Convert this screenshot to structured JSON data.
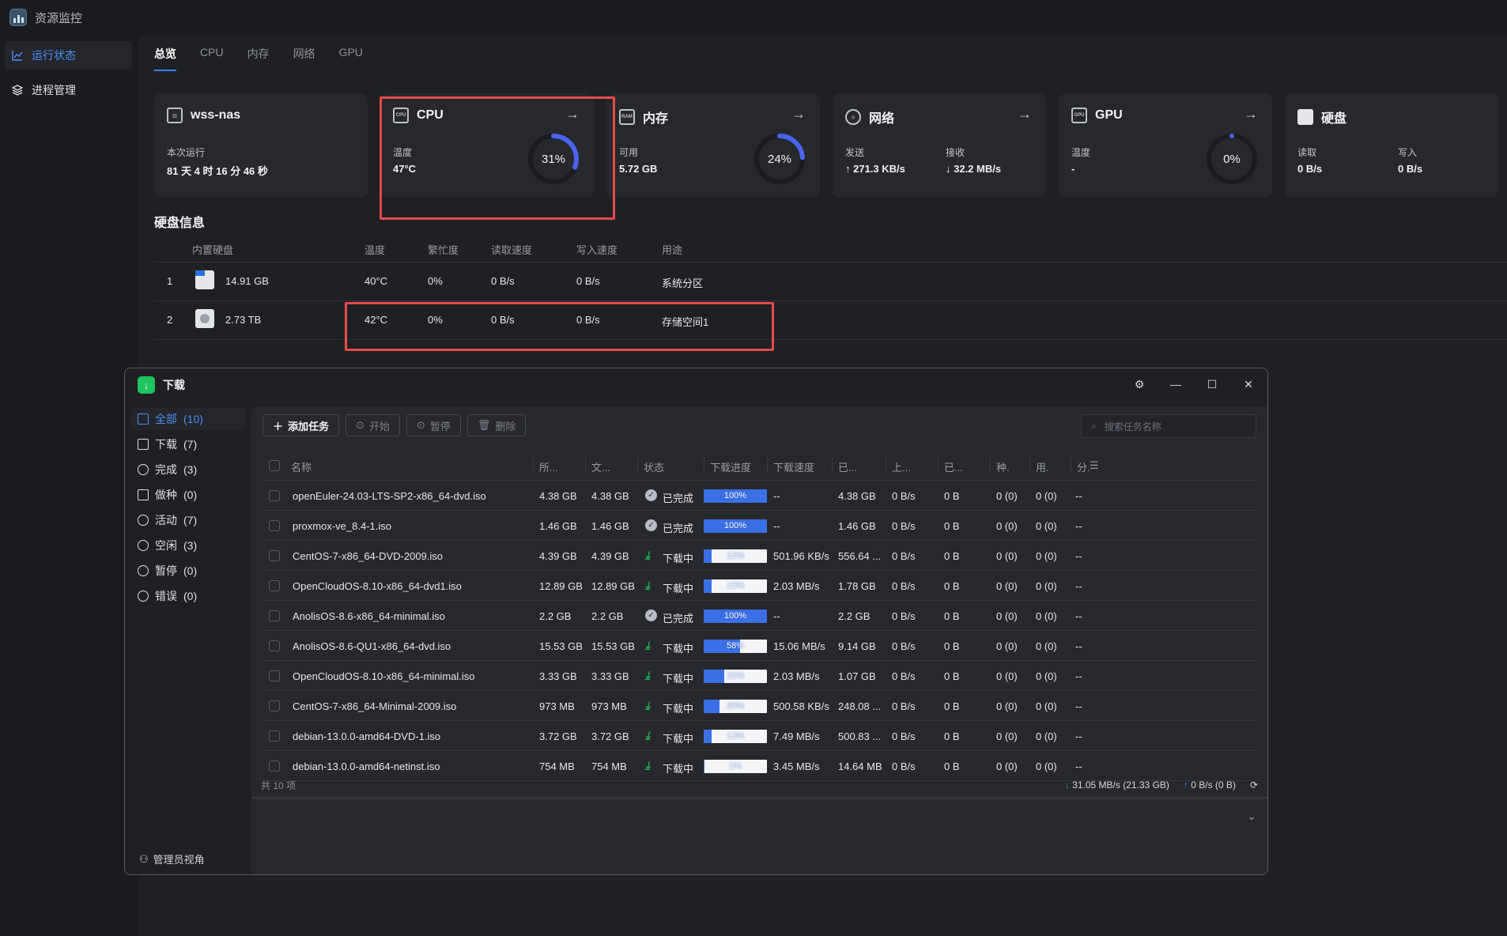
{
  "app": {
    "title": "资源监控"
  },
  "sidebar": {
    "items": [
      {
        "label": "运行状态"
      },
      {
        "label": "进程管理"
      }
    ]
  },
  "tabs": [
    "总览",
    "CPU",
    "内存",
    "网络",
    "GPU"
  ],
  "cards": {
    "host": {
      "title": "wss-nas",
      "label": "本次运行",
      "value": "81 天 4 时 16 分 46 秒"
    },
    "cpu": {
      "title": "CPU",
      "label": "温度",
      "value": "47°C",
      "gauge": "31%",
      "percent": 31,
      "chip": "CPU"
    },
    "mem": {
      "title": "内存",
      "label": "可用",
      "value": "5.72 GB",
      "gauge": "24%",
      "percent": 24,
      "chip": "RAM"
    },
    "net": {
      "title": "网络",
      "send_label": "发送",
      "send_value": "↑ 271.3 KB/s",
      "recv_label": "接收",
      "recv_value": "↓ 32.2 MB/s"
    },
    "gpu": {
      "title": "GPU",
      "label": "温度",
      "value": "-",
      "gauge": "0%",
      "percent": 0,
      "chip": "GPU"
    },
    "disk": {
      "title": "硬盘",
      "read_label": "读取",
      "read_value": "0 B/s",
      "write_label": "写入",
      "write_value": "0 B/s"
    }
  },
  "disk_section": {
    "title": "硬盘信息",
    "headers": [
      "内置硬盘",
      "温度",
      "繁忙度",
      "读取速度",
      "写入速度",
      "用途"
    ],
    "rows": [
      {
        "idx": "1",
        "icon": "ssd-icon",
        "size": "14.91 GB",
        "temp": "40°C",
        "busy": "0%",
        "read": "0 B/s",
        "write": "0 B/s",
        "use": "系统分区"
      },
      {
        "idx": "2",
        "icon": "hdd-icon",
        "size": "2.73 TB",
        "temp": "42°C",
        "busy": "0%",
        "read": "0 B/s",
        "write": "0 B/s",
        "use": "存储空间1"
      }
    ]
  },
  "download": {
    "title": "下载",
    "nav": [
      {
        "label": "全部",
        "count": "(10)"
      },
      {
        "label": "下载",
        "count": "(7)"
      },
      {
        "label": "完成",
        "count": "(3)"
      },
      {
        "label": "做种",
        "count": "(0)"
      },
      {
        "label": "活动",
        "count": "(7)"
      },
      {
        "label": "空闲",
        "count": "(3)"
      },
      {
        "label": "暂停",
        "count": "(0)"
      },
      {
        "label": "错误",
        "count": "(0)"
      }
    ],
    "admin_label": "管理员视角",
    "toolbar": {
      "add": "添加任务",
      "start": "开始",
      "pause": "暂停",
      "delete": "删除"
    },
    "search_placeholder": "搜索任务名称",
    "headers": [
      "名称",
      "所...",
      "文...",
      "状态",
      "下载进度",
      "下载速度",
      "已...",
      "上...",
      "已...",
      "种.",
      "用.",
      "分."
    ],
    "rows": [
      {
        "name": "openEuler-24.03-LTS-SP2-x86_64-dvd.iso",
        "size": "4.38 GB",
        "file": "4.38 GB",
        "status": "已完成",
        "done": true,
        "progress": 100,
        "progress_text": "100%",
        "speed": "--",
        "downloaded": "4.38 GB",
        "up_speed": "0 B/s",
        "uploaded": "0 B",
        "seeds": "0 (0)",
        "peers": "0 (0)",
        "ratio": "--"
      },
      {
        "name": "proxmox-ve_8.4-1.iso",
        "size": "1.46 GB",
        "file": "1.46 GB",
        "status": "已完成",
        "done": true,
        "progress": 100,
        "progress_text": "100%",
        "speed": "--",
        "downloaded": "1.46 GB",
        "up_speed": "0 B/s",
        "uploaded": "0 B",
        "seeds": "0 (0)",
        "peers": "0 (0)",
        "ratio": "--"
      },
      {
        "name": "CentOS-7-x86_64-DVD-2009.iso",
        "size": "4.39 GB",
        "file": "4.39 GB",
        "status": "下载中",
        "done": false,
        "progress": 12,
        "progress_text": "12%",
        "speed": "501.96 KB/s",
        "downloaded": "556.64 ...",
        "up_speed": "0 B/s",
        "uploaded": "0 B",
        "seeds": "0 (0)",
        "peers": "0 (0)",
        "ratio": "--"
      },
      {
        "name": "OpenCloudOS-8.10-x86_64-dvd1.iso",
        "size": "12.89 GB",
        "file": "12.89 GB",
        "status": "下载中",
        "done": false,
        "progress": 13,
        "progress_text": "13%",
        "speed": "2.03 MB/s",
        "downloaded": "1.78 GB",
        "up_speed": "0 B/s",
        "uploaded": "0 B",
        "seeds": "0 (0)",
        "peers": "0 (0)",
        "ratio": "--"
      },
      {
        "name": "AnolisOS-8.6-x86_64-minimal.iso",
        "size": "2.2 GB",
        "file": "2.2 GB",
        "status": "已完成",
        "done": true,
        "progress": 100,
        "progress_text": "100%",
        "speed": "--",
        "downloaded": "2.2 GB",
        "up_speed": "0 B/s",
        "uploaded": "0 B",
        "seeds": "0 (0)",
        "peers": "0 (0)",
        "ratio": "--"
      },
      {
        "name": "AnolisOS-8.6-QU1-x86_64-dvd.iso",
        "size": "15.53 GB",
        "file": "15.53 GB",
        "status": "下载中",
        "done": false,
        "progress": 58,
        "progress_text": "58%",
        "speed": "15.06 MB/s",
        "downloaded": "9.14 GB",
        "up_speed": "0 B/s",
        "uploaded": "0 B",
        "seeds": "0 (0)",
        "peers": "0 (0)",
        "ratio": "--"
      },
      {
        "name": "OpenCloudOS-8.10-x86_64-minimal.iso",
        "size": "3.33 GB",
        "file": "3.33 GB",
        "status": "下载中",
        "done": false,
        "progress": 32,
        "progress_text": "32%",
        "speed": "2.03 MB/s",
        "downloaded": "1.07 GB",
        "up_speed": "0 B/s",
        "uploaded": "0 B",
        "seeds": "0 (0)",
        "peers": "0 (0)",
        "ratio": "--"
      },
      {
        "name": "CentOS-7-x86_64-Minimal-2009.iso",
        "size": "973 MB",
        "file": "973 MB",
        "status": "下载中",
        "done": false,
        "progress": 25,
        "progress_text": "25%",
        "speed": "500.58 KB/s",
        "downloaded": "248.08 ...",
        "up_speed": "0 B/s",
        "uploaded": "0 B",
        "seeds": "0 (0)",
        "peers": "0 (0)",
        "ratio": "--"
      },
      {
        "name": "debian-13.0.0-amd64-DVD-1.iso",
        "size": "3.72 GB",
        "file": "3.72 GB",
        "status": "下载中",
        "done": false,
        "progress": 13,
        "progress_text": "13%",
        "speed": "7.49 MB/s",
        "downloaded": "500.83 ...",
        "up_speed": "0 B/s",
        "uploaded": "0 B",
        "seeds": "0 (0)",
        "peers": "0 (0)",
        "ratio": "--"
      },
      {
        "name": "debian-13.0.0-amd64-netinst.iso",
        "size": "754 MB",
        "file": "754 MB",
        "status": "下载中",
        "done": false,
        "progress": 1,
        "progress_text": "1%",
        "speed": "3.45 MB/s",
        "downloaded": "14.64 MB",
        "up_speed": "0 B/s",
        "uploaded": "0 B",
        "seeds": "0 (0)",
        "peers": "0 (0)",
        "ratio": "--"
      }
    ],
    "footer": {
      "total": "共 10 项",
      "down": "31.05 MB/s (21.33 GB)",
      "up": "0 B/s (0 B)"
    }
  },
  "colors": {
    "accent": "#3e7bef",
    "highlight": "#e84a4a",
    "download_green": "#21b24f",
    "progress_blue": "#3a6fe6"
  }
}
